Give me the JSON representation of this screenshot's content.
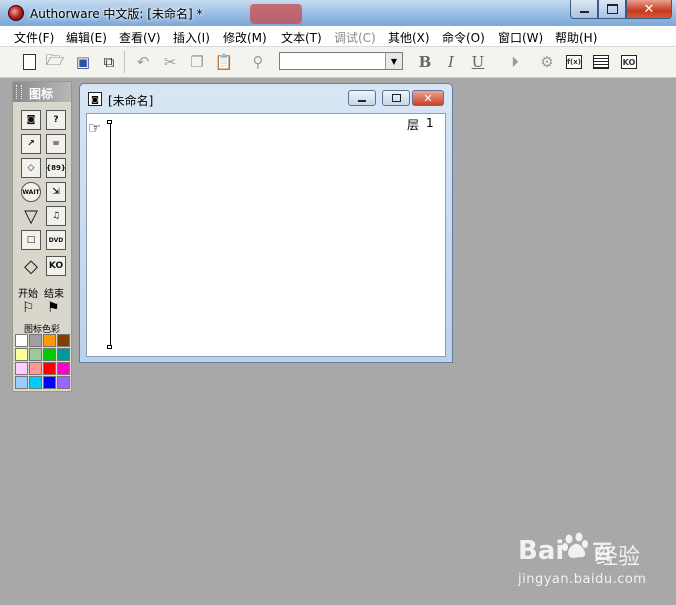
{
  "window": {
    "title": "Authorware 中文版: [未命名] *",
    "close_glyph": "✕"
  },
  "menu": [
    {
      "label": "文件(F)",
      "enabled": true
    },
    {
      "label": "编辑(E)",
      "enabled": true
    },
    {
      "label": "查看(V)",
      "enabled": true
    },
    {
      "label": "插入(I)",
      "enabled": true
    },
    {
      "label": "修改(M)",
      "enabled": true
    },
    {
      "label": "文本(T)",
      "enabled": true
    },
    {
      "label": "调试(C)",
      "enabled": false
    },
    {
      "label": "其他(X)",
      "enabled": true
    },
    {
      "label": "命令(O)",
      "enabled": true
    },
    {
      "label": "窗口(W)",
      "enabled": true
    },
    {
      "label": "帮助(H)",
      "enabled": true
    }
  ],
  "toolbar": {
    "font_combo_value": "",
    "bold": "B",
    "italic": "I",
    "underline": "U",
    "function_icon": "f(x)",
    "knowledge_object_icon": "KO"
  },
  "palette": {
    "title": "图标",
    "icons": [
      {
        "name": "display-icon"
      },
      {
        "name": "interaction-icon"
      },
      {
        "name": "motion-icon"
      },
      {
        "name": "calculation-icon"
      },
      {
        "name": "erase-icon"
      },
      {
        "name": "map-icon"
      },
      {
        "name": "wait-icon"
      },
      {
        "name": "digital-movie-icon"
      },
      {
        "name": "navigate-icon"
      },
      {
        "name": "sound-icon"
      },
      {
        "name": "framework-icon"
      },
      {
        "name": "dvd-icon"
      },
      {
        "name": "decision-icon"
      },
      {
        "name": "knowledge-object-icon"
      }
    ],
    "icon_text": {
      "wait": "WAIT",
      "map": "{89}",
      "dvd": "DVD",
      "ko": "KO",
      "calc": "="
    },
    "start_label": "开始",
    "end_label": "结束",
    "color_label": "图标色彩",
    "colors": [
      "#ffffff",
      "#a0a0a0",
      "#ff9900",
      "#804000",
      "#ffff99",
      "#99cc99",
      "#00cc00",
      "#009999",
      "#ffccff",
      "#ff9999",
      "#ff0000",
      "#ff00cc",
      "#99ccff",
      "#00ccff",
      "#0000ff",
      "#9966ff"
    ]
  },
  "flow_window": {
    "title": "[未命名]",
    "layer_label": "层",
    "layer_number": "1"
  },
  "watermark": {
    "logo": "Bai",
    "logo_end": "百",
    "name": "经验",
    "url": "jingyan.baidu.com"
  }
}
